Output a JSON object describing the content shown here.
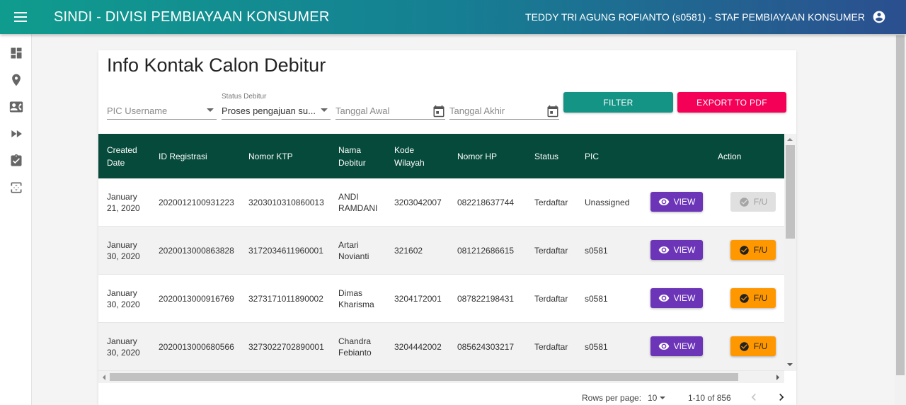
{
  "header": {
    "app_title": "SINDI - DIVISI PEMBIAYAAN KONSUMER",
    "user_info": "TEDDY TRI AGUNG ROFIANTO (s0581) - STAF PEMBIAYAAN KONSUMER",
    "menu_icon": "menu-icon",
    "user_icon": "account-circle-icon"
  },
  "sidebar": {
    "icons": [
      "dashboard-icon",
      "location-pin-icon",
      "contact-card-icon",
      "fast-forward-icon",
      "assignment-check-icon",
      "import-export-icon"
    ]
  },
  "page": {
    "title": "Info Kontak Calon Debitur"
  },
  "filters": {
    "pic_placeholder": "PIC Username",
    "status_label": "Status Debitur",
    "status_value": "Proses pengajuan su...",
    "start_date_placeholder": "Tanggal Awal",
    "end_date_placeholder": "Tanggal Akhir",
    "filter_button": "FILTER",
    "export_button": "EXPORT TO PDF"
  },
  "table": {
    "headers": {
      "created_date": "Created Date",
      "id_registrasi": "ID Registrasi",
      "nomor_ktp": "Nomor KTP",
      "nama_debitur": "Nama Debitur",
      "kode_wilayah": "Kode Wilayah",
      "nomor_hp": "Nomor HP",
      "status": "Status",
      "pic": "PIC",
      "action": "Action"
    },
    "view_label": "VIEW",
    "fu_label": "F/U",
    "rows": [
      {
        "created_date": "January 21, 2020",
        "id_registrasi": "2020012100931223",
        "nomor_ktp": "3203010310860013",
        "nama_debitur": "ANDI RAMDANI",
        "kode_wilayah": "3203042007",
        "nomor_hp": "082218637744",
        "status": "Terdaftar",
        "pic": "Unassigned",
        "fu_enabled": false
      },
      {
        "created_date": "January 30, 2020",
        "id_registrasi": "2020013000863828",
        "nomor_ktp": "3172034611960001",
        "nama_debitur": "Artari Novianti",
        "kode_wilayah": "321602",
        "nomor_hp": "081212686615",
        "status": "Terdaftar",
        "pic": "s0581",
        "fu_enabled": true
      },
      {
        "created_date": "January 30, 2020",
        "id_registrasi": "2020013000916769",
        "nomor_ktp": "3273171011890002",
        "nama_debitur": "Dimas Kharisma",
        "kode_wilayah": "3204172001",
        "nomor_hp": "087822198431",
        "status": "Terdaftar",
        "pic": "s0581",
        "fu_enabled": true
      },
      {
        "created_date": "January 30, 2020",
        "id_registrasi": "2020013000680566",
        "nomor_ktp": "3273022702890001",
        "nama_debitur": "Chandra Febianto",
        "kode_wilayah": "3204442002",
        "nomor_hp": "085624303217",
        "status": "Terdaftar",
        "pic": "s0581",
        "fu_enabled": true
      }
    ]
  },
  "pagination": {
    "rows_per_page_label": "Rows per page:",
    "rows_per_page_value": "10",
    "range_label": "1-10 of 856"
  },
  "colors": {
    "header_gradient_start": "#0f9c8e",
    "header_gradient_end": "#2b4f8f",
    "table_header": "#064a3b",
    "filter_button": "#149485",
    "export_button": "#f50057",
    "view_button": "#6c35b8",
    "fu_button": "#ff9800"
  }
}
